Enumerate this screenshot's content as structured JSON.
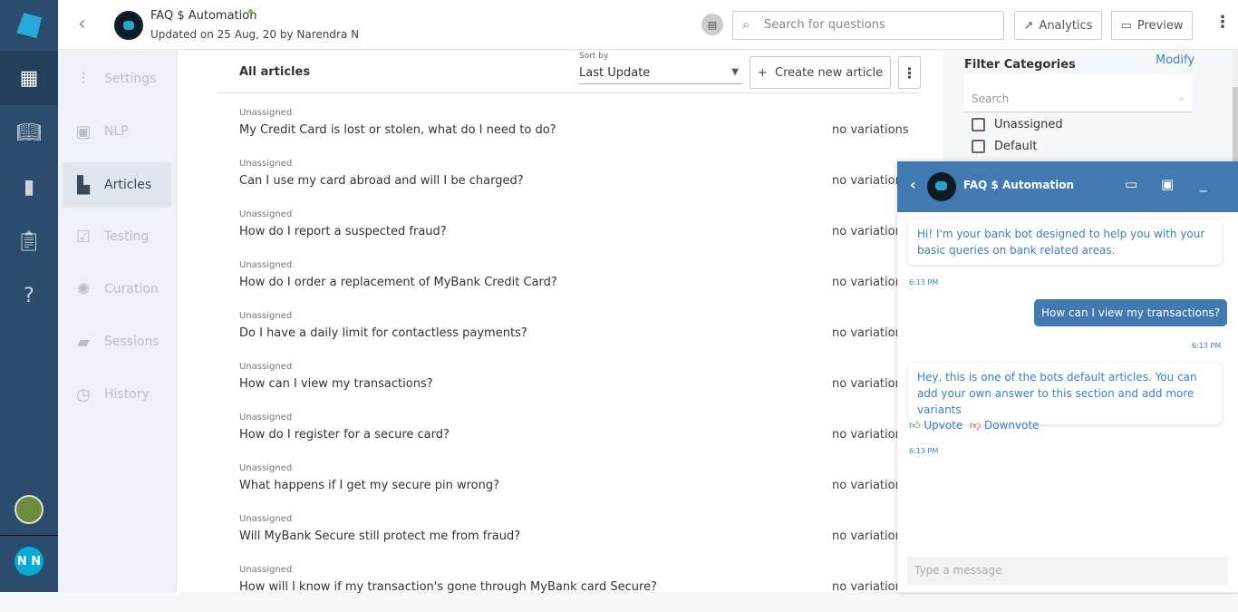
{
  "app": {
    "title": "FAQ $ Automation",
    "updated": "Updated on 25 Aug, 20 by Narendra N",
    "user_initials": "N N",
    "online_color": "#6fce2f",
    "accent": "#4279b0"
  },
  "header": {
    "search_placeholder": "Search for questions",
    "analytics": "Analytics",
    "preview": "Preview"
  },
  "subnav": [
    {
      "label": "Settings",
      "icon": "sliders-icon"
    },
    {
      "label": "NLP",
      "icon": "chip-icon"
    },
    {
      "label": "Articles",
      "icon": "document-icon",
      "active": true
    },
    {
      "label": "Testing",
      "icon": "clipboard-check-icon"
    },
    {
      "label": "Curation",
      "icon": "lightbulb-icon"
    },
    {
      "label": "Sessions",
      "icon": "chat-icon"
    },
    {
      "label": "History",
      "icon": "history-icon"
    }
  ],
  "main": {
    "title": "All articles",
    "sort_label": "Sort by",
    "sort_value": "Last Update",
    "create": "Create new article",
    "articles": [
      {
        "category": "Unassigned",
        "question": "My Credit Card is lost or stolen, what do I need to do?",
        "variations": "no variations"
      },
      {
        "category": "Unassigned",
        "question": "Can I use my card abroad and will I be charged?",
        "variations": "no variations"
      },
      {
        "category": "Unassigned",
        "question": "How do I report a suspected fraud?",
        "variations": "no variations"
      },
      {
        "category": "Unassigned",
        "question": "How do I order a replacement of MyBank Credit Card?",
        "variations": "no variations"
      },
      {
        "category": "Unassigned",
        "question": "Do I have a daily limit for contactless payments?",
        "variations": "no variations"
      },
      {
        "category": "Unassigned",
        "question": "How can I view my transactions?",
        "variations": "no variations"
      },
      {
        "category": "Unassigned",
        "question": "How do I register for a secure card?",
        "variations": "no variations"
      },
      {
        "category": "Unassigned",
        "question": "What happens if I get my secure pin wrong?",
        "variations": "no variations"
      },
      {
        "category": "Unassigned",
        "question": "Will MyBank Secure still protect me from fraud?",
        "variations": "no variations"
      },
      {
        "category": "Unassigned",
        "question": "How will I know if my transaction's gone through MyBank card Secure?",
        "variations": "no variations"
      }
    ]
  },
  "filter": {
    "title": "Filter Categories",
    "modify": "Modify",
    "search_placeholder": "Search",
    "options": [
      "Unassigned",
      "Default"
    ]
  },
  "chat": {
    "title": "FAQ $ Automation",
    "bot1": "Hi! I'm your bank bot designed to help you with your basic queries on bank related areas.",
    "t1": "6:13 PM",
    "user": "How can I view my transactions?",
    "t2": "6:13 PM",
    "bot2": "Hey, this is one of the bots default articles. You can add your own answer to this section and add more variants",
    "upvote": "Upvote",
    "downvote": "Downvote",
    "t3": "6:13 PM",
    "placeholder": "Type a message"
  }
}
